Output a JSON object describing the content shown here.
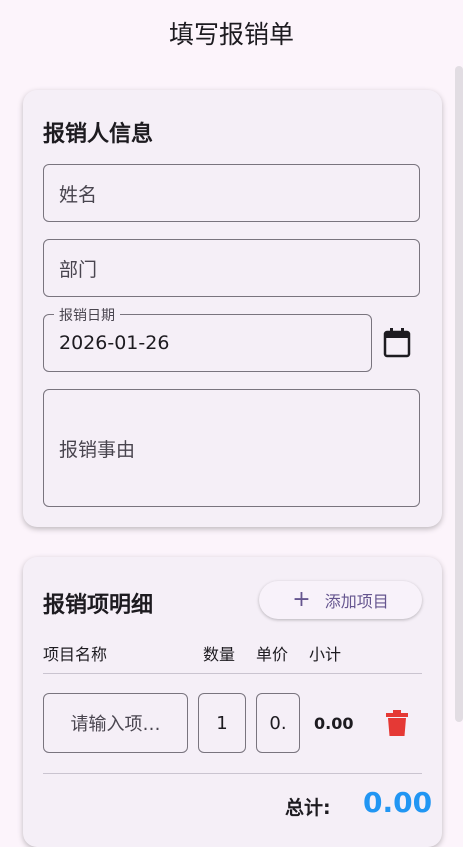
{
  "appbar": {
    "title": "填写报销单"
  },
  "applicant": {
    "section_title": "报销人信息",
    "name_placeholder": "姓名",
    "department_placeholder": "部门",
    "date_label": "报销日期",
    "date_value": "2026-01-26",
    "reason_placeholder": "报销事由"
  },
  "items": {
    "section_title": "报销项明细",
    "add_button": "添加项目",
    "columns": [
      "项目名称",
      "数量",
      "单价",
      "小计"
    ],
    "rows": [
      {
        "name_placeholder": "请输入项…",
        "quantity": "1",
        "price": "0.",
        "subtotal": "0.00"
      }
    ],
    "total_label": "总计:",
    "total_value": "0.00"
  },
  "colors": {
    "background": "#fcf4fb",
    "card": "#f5eff7",
    "accent": "#65558f",
    "total": "#2196f3",
    "delete": "#e53935"
  }
}
